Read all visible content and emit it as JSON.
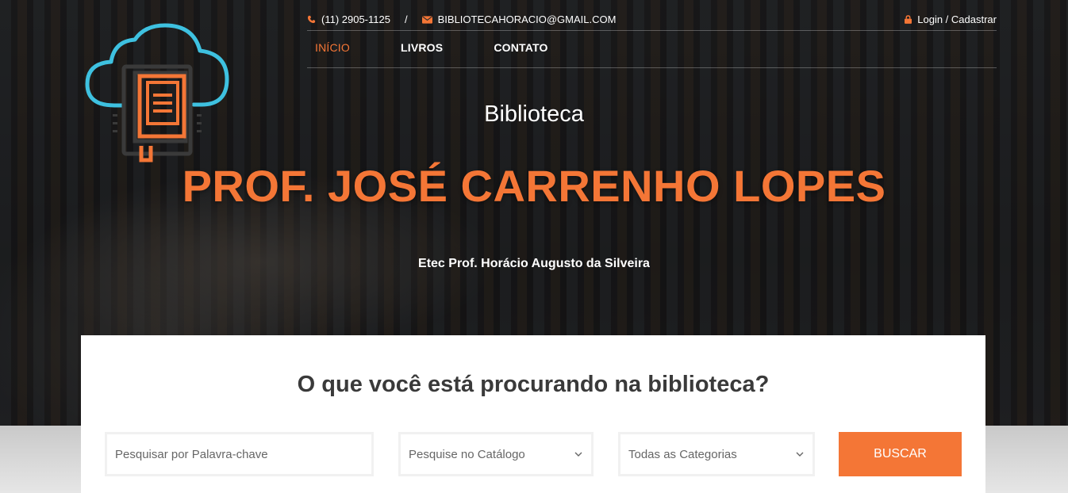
{
  "topbar": {
    "phone": "(11) 2905-1125",
    "separator": "/",
    "email": "BIBLIOTECAHORACIO@GMAIL.COM",
    "login": "Login / Cadastrar"
  },
  "nav": {
    "items": [
      {
        "label": "INÍCIO",
        "active": true
      },
      {
        "label": "LIVROS",
        "active": false
      },
      {
        "label": "CONTATO",
        "active": false
      }
    ]
  },
  "hero": {
    "kicker": "Biblioteca",
    "title": "PROF. JOSÉ CARRENHO LOPES",
    "subtitle": "Etec Prof. Horácio Augusto da Silveira"
  },
  "search": {
    "heading": "O que você está procurando na biblioteca?",
    "keyword_placeholder": "Pesquisar por Palavra-chave",
    "catalog_selected": "Pesquise no Catálogo",
    "category_selected": "Todas as Categorias",
    "button": "BUSCAR"
  },
  "colors": {
    "accent": "#f47636",
    "logo_cloud": "#3ec1e0",
    "logo_book": "#3a3a3a"
  },
  "icons": {
    "phone": "phone-icon",
    "email": "envelope-icon",
    "login": "lock-icon",
    "select": "chevron-down-icon",
    "logo": "cloud-book-logo"
  }
}
